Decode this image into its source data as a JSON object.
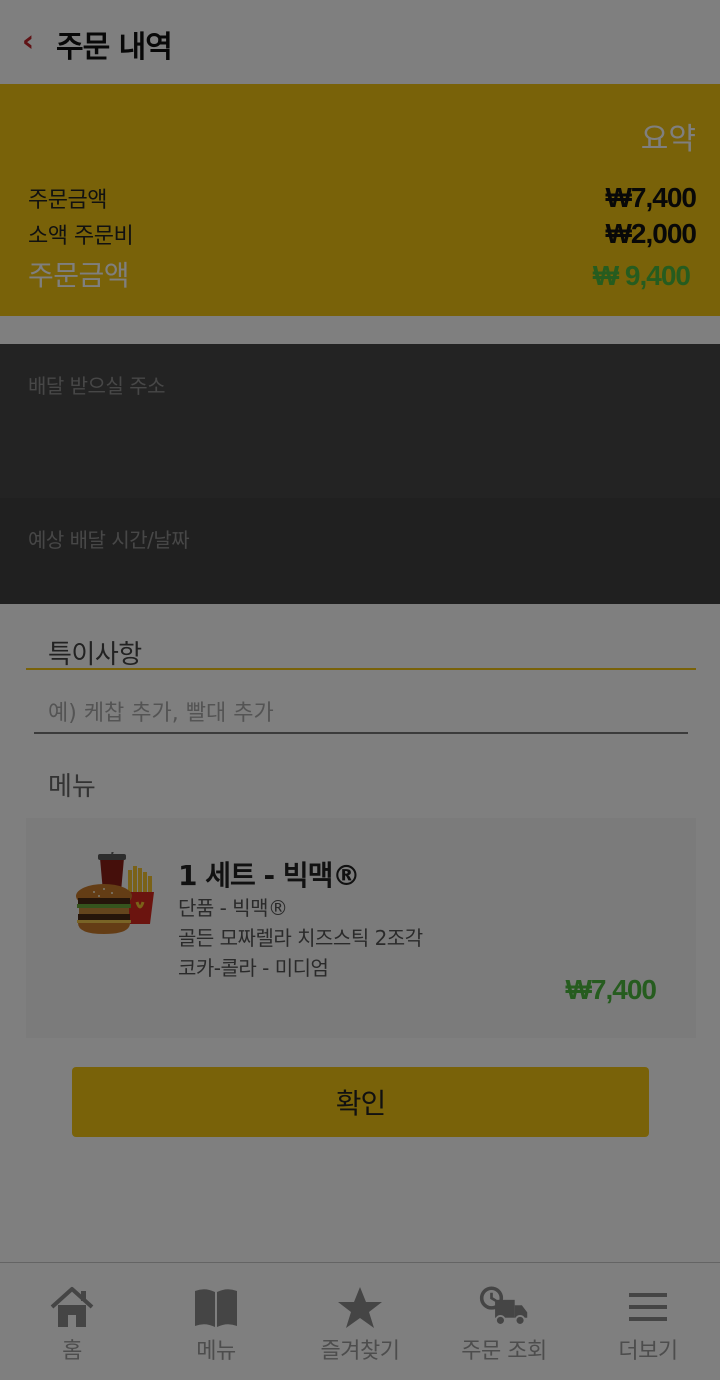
{
  "header": {
    "back_icon": "chevron-left-icon",
    "back_glyph": "‹",
    "title": "주문 내역"
  },
  "summary": {
    "title": "요약",
    "rows": [
      {
        "label": "주문금액",
        "value": "₩7,400"
      },
      {
        "label": "소액 주문비",
        "value": "₩2,000"
      },
      {
        "label": "주문금액",
        "value": "₩ 9,400"
      }
    ]
  },
  "delivery": {
    "address_label": "배달 받으실 주소",
    "time_label": "예상 배달 시간/날짜"
  },
  "special": {
    "title": "특이사항",
    "placeholder": "예) 케찹 추가, 빨대 추가"
  },
  "menu": {
    "title": "메뉴",
    "item": {
      "name": "1 세트 - 빅맥®",
      "components": [
        "단품 - 빅맥®",
        "골든 모짜렐라 치즈스틱 2조각",
        "코카-콜라 - 미디엄"
      ],
      "price": "₩7,400"
    }
  },
  "confirm": {
    "label": "확인"
  },
  "bottom_nav": [
    {
      "label": "홈",
      "icon": "home-icon"
    },
    {
      "label": "메뉴",
      "icon": "book-icon"
    },
    {
      "label": "즐겨찾기",
      "icon": "star-icon"
    },
    {
      "label": "주문 조회",
      "icon": "delivery-truck-icon"
    },
    {
      "label": "더보기",
      "icon": "hamburger-menu-icon"
    }
  ],
  "colors": {
    "brand_yellow": "#f3c512",
    "price_green": "#4cb93f",
    "back_red": "#c0272d",
    "dark_panel": "#474747"
  }
}
